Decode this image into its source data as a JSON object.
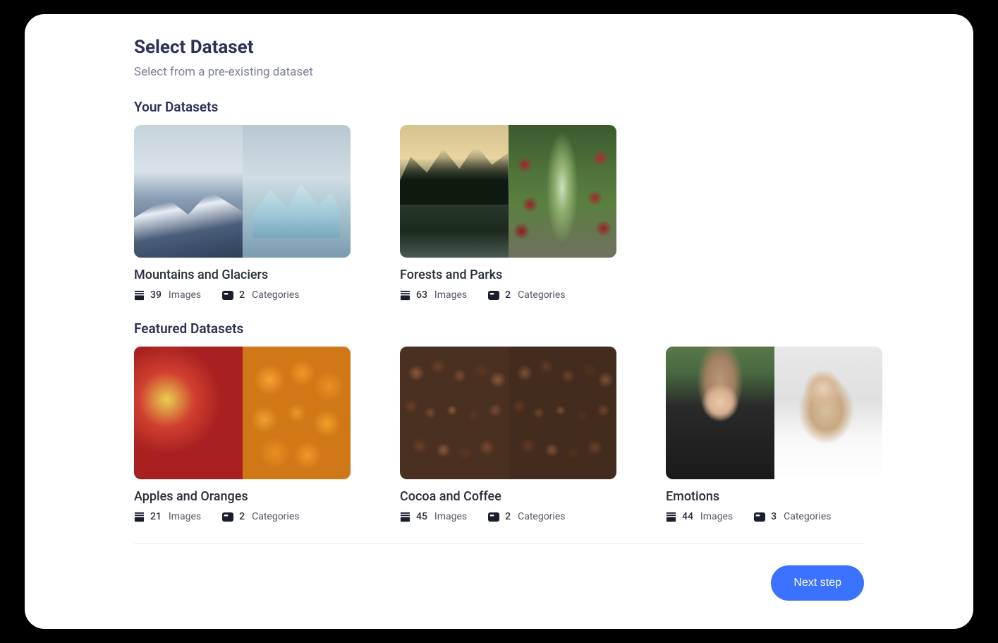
{
  "page": {
    "title": "Select Dataset",
    "subtitle": "Select from a pre-existing dataset"
  },
  "sections": {
    "your": "Your Datasets",
    "featured": "Featured Datasets"
  },
  "labels": {
    "images": "Images",
    "categories": "Categories"
  },
  "your_datasets": [
    {
      "name": "Mountains and Glaciers",
      "images": "39",
      "categories": "2"
    },
    {
      "name": "Forests and Parks",
      "images": "63",
      "categories": "2"
    }
  ],
  "featured_datasets": [
    {
      "name": "Apples and Oranges",
      "images": "21",
      "categories": "2"
    },
    {
      "name": "Cocoa and Coffee",
      "images": "45",
      "categories": "2"
    },
    {
      "name": "Emotions",
      "images": "44",
      "categories": "3"
    }
  ],
  "footer": {
    "next": "Next step"
  }
}
